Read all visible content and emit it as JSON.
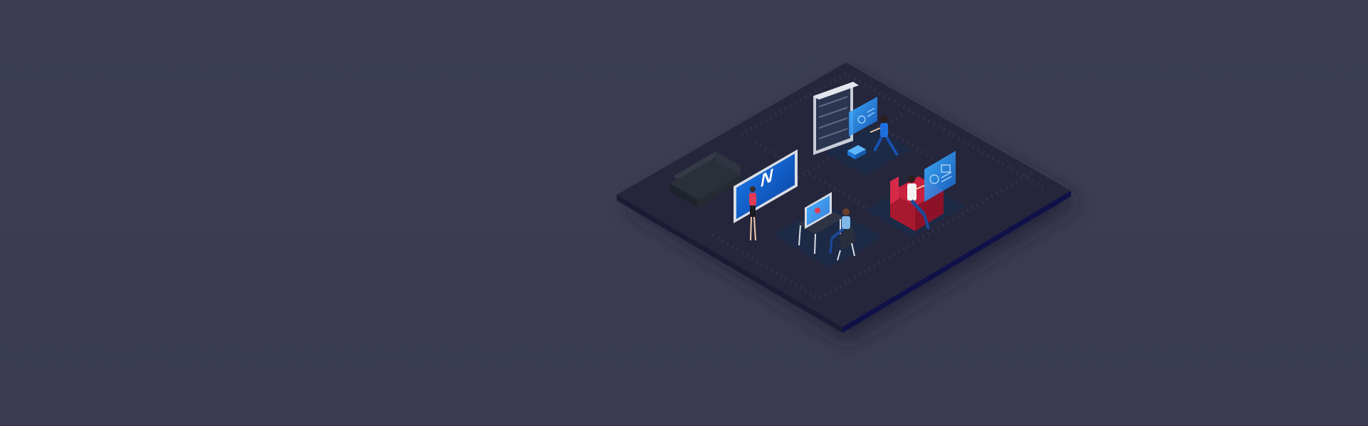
{
  "scene": {
    "background_color": "#3b3c52",
    "platform_top_color": "#24243a",
    "platform_side_color": "#15153a",
    "accent_color": "#1e6fd9",
    "zones": [
      {
        "name": "lounge",
        "items": [
          "sofa-icon",
          "presentation-screen-icon",
          "presenter-icon"
        ]
      },
      {
        "name": "server-room",
        "items": [
          "server-rack-icon",
          "hologram-panel-icon",
          "vr-user-kneeling-icon",
          "device-box-icon"
        ]
      },
      {
        "name": "workstation",
        "items": [
          "desk-icon",
          "monitor-icon",
          "seated-user-icon",
          "chair-icon"
        ]
      },
      {
        "name": "vr-lounge",
        "items": [
          "armchair-icon",
          "vr-user-seated-icon",
          "hologram-dashboard-icon"
        ]
      }
    ]
  }
}
